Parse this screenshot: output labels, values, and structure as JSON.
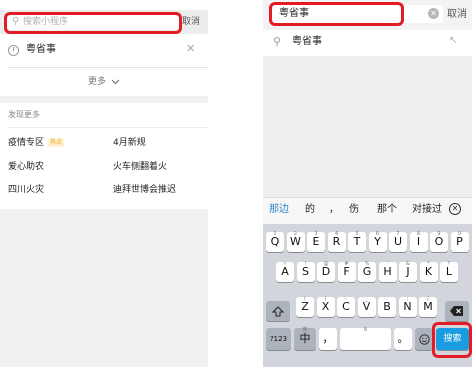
{
  "left_panel": {
    "search_placeholder": "搜索小程序",
    "cancel": "取消",
    "history_item": "粤省事",
    "more": "更多",
    "section_title": "发现更多",
    "trends": [
      {
        "label": "疫情专区",
        "badge": "热点"
      },
      {
        "label": "4月新规",
        "badge": ""
      },
      {
        "label": "爱心助农",
        "badge": ""
      },
      {
        "label": "火车侧翻着火",
        "badge": ""
      },
      {
        "label": "四川火灾",
        "badge": ""
      },
      {
        "label": "迪拜世博会推迟",
        "badge": ""
      }
    ]
  },
  "right_panel": {
    "query": "粤省事",
    "cancel": "取消",
    "suggestion": "粤省事",
    "candidates": [
      "那边",
      "的",
      "，",
      "伤",
      "那个",
      "对接过"
    ],
    "keyboard": {
      "row1": [
        {
          "k": "Q",
          "s": "1"
        },
        {
          "k": "W",
          "s": "2"
        },
        {
          "k": "E",
          "s": "3"
        },
        {
          "k": "R",
          "s": "4"
        },
        {
          "k": "T",
          "s": "5"
        },
        {
          "k": "Y",
          "s": "6"
        },
        {
          "k": "U",
          "s": "7"
        },
        {
          "k": "I",
          "s": "8"
        },
        {
          "k": "O",
          "s": "9"
        },
        {
          "k": "P",
          "s": "0"
        }
      ],
      "row2": [
        {
          "k": "A",
          "s": "~"
        },
        {
          "k": "S",
          "s": "!"
        },
        {
          "k": "D",
          "s": "@"
        },
        {
          "k": "F",
          "s": "#"
        },
        {
          "k": "G",
          "s": "%"
        },
        {
          "k": "H",
          "s": "'"
        },
        {
          "k": "J",
          "s": "&"
        },
        {
          "k": "K",
          "s": "*"
        },
        {
          "k": "L",
          "s": "?"
        }
      ],
      "row3": [
        {
          "k": "Z",
          "s": "("
        },
        {
          "k": "X",
          "s": ")"
        },
        {
          "k": "C",
          "s": "-"
        },
        {
          "k": "V",
          "s": "_"
        },
        {
          "k": "B",
          "s": ":"
        },
        {
          "k": "N",
          "s": ";"
        },
        {
          "k": "M",
          "s": "/"
        }
      ],
      "num_key": "?123",
      "lang_key": "中",
      "lang_key_sub": "英",
      "comma_key": "，",
      "space_sub": "8",
      "period_key": "。",
      "search_key": "搜索"
    }
  }
}
